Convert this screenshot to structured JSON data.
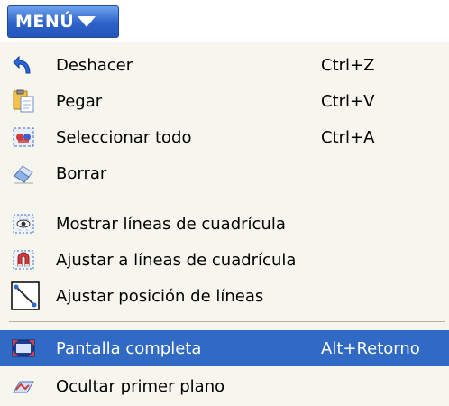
{
  "menu_button": {
    "label": "MENÚ",
    "icon": "chevron-down-icon",
    "color": "#2d62c9"
  },
  "items": [
    {
      "label": "Deshacer",
      "shortcut": "Ctrl+Z",
      "icon": "undo-icon"
    },
    {
      "label": "Pegar",
      "shortcut": "Ctrl+V",
      "icon": "paste-icon"
    },
    {
      "label": "Seleccionar todo",
      "shortcut": "Ctrl+A",
      "icon": "select-all-icon"
    },
    {
      "label": "Borrar",
      "shortcut": "",
      "icon": "eraser-icon"
    },
    {
      "label": "Mostrar líneas de cuadrícula",
      "shortcut": "",
      "icon": "grid-eye-icon"
    },
    {
      "label": "Ajustar a líneas de cuadrícula",
      "shortcut": "",
      "icon": "grid-magnet-icon"
    },
    {
      "label": "Ajustar posición de líneas",
      "shortcut": "",
      "icon": "line-position-icon"
    },
    {
      "label": "Pantalla completa",
      "shortcut": "Alt+Retorno",
      "icon": "fullscreen-icon",
      "highlighted": true
    },
    {
      "label": "Ocultar primer plano",
      "shortcut": "",
      "icon": "hide-foreground-icon"
    }
  ],
  "colors": {
    "panel": "#f7f6ee",
    "highlight": "#316ac5",
    "separator": "#b6b39e"
  }
}
